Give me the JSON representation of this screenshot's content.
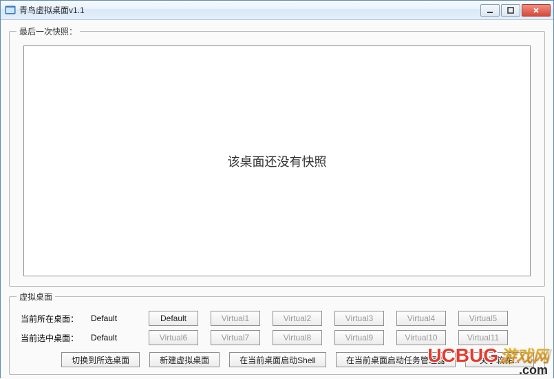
{
  "window": {
    "title": "青鸟虚拟桌面v1.1"
  },
  "snapshot": {
    "group_label": "最后一次快照：",
    "empty_text": "该桌面还没有快照"
  },
  "desktops": {
    "group_label": "虚拟桌面",
    "current_location_label": "当前所在桌面：",
    "current_location_value": "Default",
    "current_selected_label": "当前选中桌面：",
    "current_selected_value": "Default",
    "row1_buttons": [
      "Default",
      "Virtual1",
      "Virtual2",
      "Virtual3",
      "Virtual4",
      "Virtual5"
    ],
    "row1_enabled": [
      true,
      false,
      false,
      false,
      false,
      false
    ],
    "row2_buttons": [
      "Virtual6",
      "Virtual7",
      "Virtual8",
      "Virtual9",
      "Virtual10",
      "Virtual11"
    ],
    "row2_enabled": [
      false,
      false,
      false,
      false,
      false,
      false
    ]
  },
  "actions": {
    "switch": "切换到所选桌面",
    "create": "新建虚拟桌面",
    "start_shell": "在当前桌面启动Shell",
    "start_taskmgr": "在当前桌面启动任务管理器",
    "about": "关于软件..."
  },
  "watermark": {
    "brand": "UCBUG",
    "cn": "游戏网",
    "sub": ".com"
  }
}
